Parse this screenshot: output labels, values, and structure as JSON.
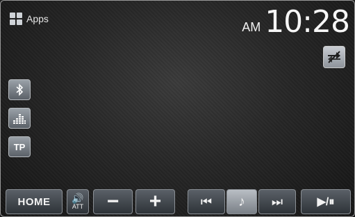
{
  "header": {
    "apps_label": "Apps",
    "ampm": "AM",
    "time": "10:28"
  },
  "side_buttons": {
    "bluetooth_icon": "bluetooth-icon",
    "equalizer_icon": "equalizer-icon",
    "tp_label": "TP"
  },
  "bottom_bar": {
    "home_label": "HOME",
    "att_label": "ATT",
    "minus_label": "−",
    "plus_label": "+",
    "prev_label": "⏮",
    "music_label": "♪",
    "next_label": "⏭",
    "playpause_label": "▶/⏸"
  }
}
